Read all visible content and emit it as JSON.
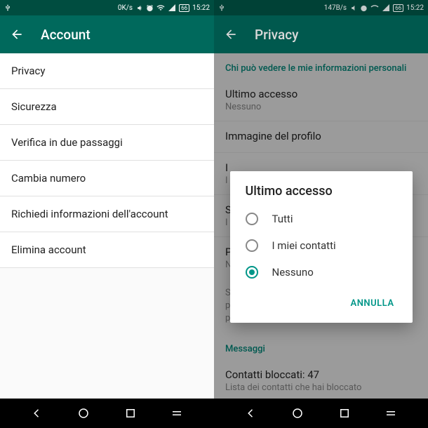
{
  "left": {
    "status": {
      "speed": "0K/s",
      "battery": "66",
      "time": "15:22"
    },
    "appbar": {
      "title": "Account"
    },
    "items": [
      "Privacy",
      "Sicurezza",
      "Verifica in due passaggi",
      "Cambia numero",
      "Richiedi informazioni dell'account",
      "Elimina account"
    ]
  },
  "right": {
    "status": {
      "speed": "147B/s",
      "battery": "66",
      "time": "15:22"
    },
    "appbar": {
      "title": "Privacy"
    },
    "section1": "Chi può vedere le mie informazioni personali",
    "settings": [
      {
        "title": "Ultimo accesso",
        "sub": "Nessuno"
      },
      {
        "title": "Immagine del profilo",
        "sub": ""
      },
      {
        "title": "I",
        "sub": "I"
      },
      {
        "title": "S",
        "sub": "I"
      },
      {
        "title": "P",
        "sub": "N"
      }
    ],
    "info": "Se non condividi il tuo ultimo accesso non potrai vedere l'ultimo accesso delle altre persone",
    "section2": "Messaggi",
    "blocked": {
      "title": "Contatti bloccati: 47",
      "sub": "Lista dei contatti che hai bloccato"
    },
    "dialog": {
      "title": "Ultimo accesso",
      "options": [
        "Tutti",
        "I miei contatti",
        "Nessuno"
      ],
      "selected": 2,
      "cancel": "ANNULLA"
    }
  }
}
